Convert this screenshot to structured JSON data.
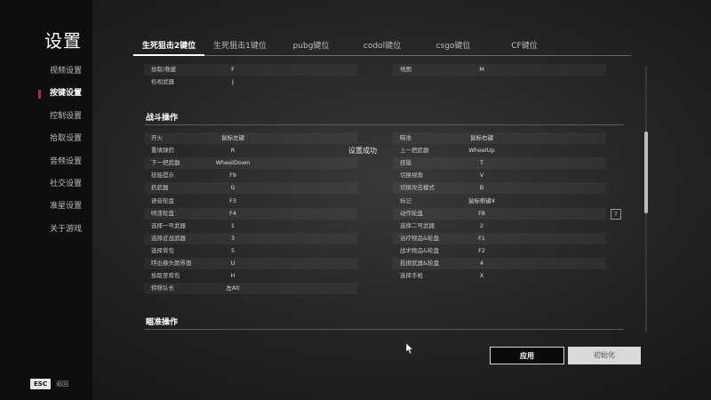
{
  "sidebar": {
    "title": "设置",
    "items": [
      {
        "label": "视频设置",
        "active": false
      },
      {
        "label": "按键设置",
        "active": true
      },
      {
        "label": "控制设置",
        "active": false
      },
      {
        "label": "拾取设置",
        "active": false
      },
      {
        "label": "音频设置",
        "active": false
      },
      {
        "label": "社交设置",
        "active": false
      },
      {
        "label": "准星设置",
        "active": false
      },
      {
        "label": "关于游戏",
        "active": false
      }
    ],
    "esc_key": "ESC",
    "esc_label": "返回"
  },
  "tabs": [
    {
      "label": "生死狙击2键位",
      "active": true
    },
    {
      "label": "生死狙击1键位",
      "active": false
    },
    {
      "label": "pubg键位",
      "active": false
    },
    {
      "label": "codol键位",
      "active": false
    },
    {
      "label": "csgo键位",
      "active": false
    },
    {
      "label": "CF键位",
      "active": false
    }
  ],
  "top_rows": [
    {
      "left_label": "拾取/救援",
      "left_value": "F",
      "right_label": "地图",
      "right_value": "M"
    },
    {
      "left_label": "检视武器",
      "left_value": "J",
      "right_label": "",
      "right_value": ""
    }
  ],
  "combat": {
    "title": "战斗操作",
    "rows": [
      {
        "left_label": "开火",
        "left_value": "鼠标左键",
        "right_label": "瞄准",
        "right_value": "鼠标右键"
      },
      {
        "left_label": "重填弹药",
        "left_value": "R",
        "right_label": "上一把武器",
        "right_value": "WheelUp"
      },
      {
        "left_label": "下一把武器",
        "left_value": "WheelDown",
        "right_label": "技能",
        "right_value": "T"
      },
      {
        "left_label": "技能提示",
        "left_value": "F9",
        "right_label": "切换视角",
        "right_value": "V"
      },
      {
        "left_label": "扔武器",
        "left_value": "G",
        "right_label": "切换攻击模式",
        "right_value": "B"
      },
      {
        "left_label": "语音轮盘",
        "left_value": "F3",
        "right_label": "标记",
        "right_value": "鼠标侧键4"
      },
      {
        "left_label": "喷漆轮盘",
        "left_value": "F4",
        "right_label": "动作轮盘",
        "right_value": "F8"
      },
      {
        "left_label": "选择一号武器",
        "left_value": "1",
        "right_label": "选择二号武器",
        "right_value": "2"
      },
      {
        "left_label": "选择近战武器",
        "left_value": "3",
        "right_label": "治疗物品&轮盘",
        "right_value": "F1"
      },
      {
        "left_label": "选择背包",
        "left_value": "5",
        "right_label": "战术物品&轮盘",
        "right_value": "F2"
      },
      {
        "left_label": "呼出换头颜界面",
        "left_value": "U",
        "right_label": "投掷武器&轮盘",
        "right_value": "4"
      },
      {
        "left_label": "拾取至背包",
        "left_value": "H",
        "right_label": "选择手枪",
        "right_value": "X"
      },
      {
        "left_label": "转移队长",
        "left_value": "左Alt",
        "right_label": "",
        "right_value": ""
      }
    ]
  },
  "aim": {
    "title": "瞄准操作"
  },
  "toast": "设置成功",
  "help_icon_glyph": "?",
  "buttons": {
    "apply": "应用",
    "reset": "初始化"
  }
}
